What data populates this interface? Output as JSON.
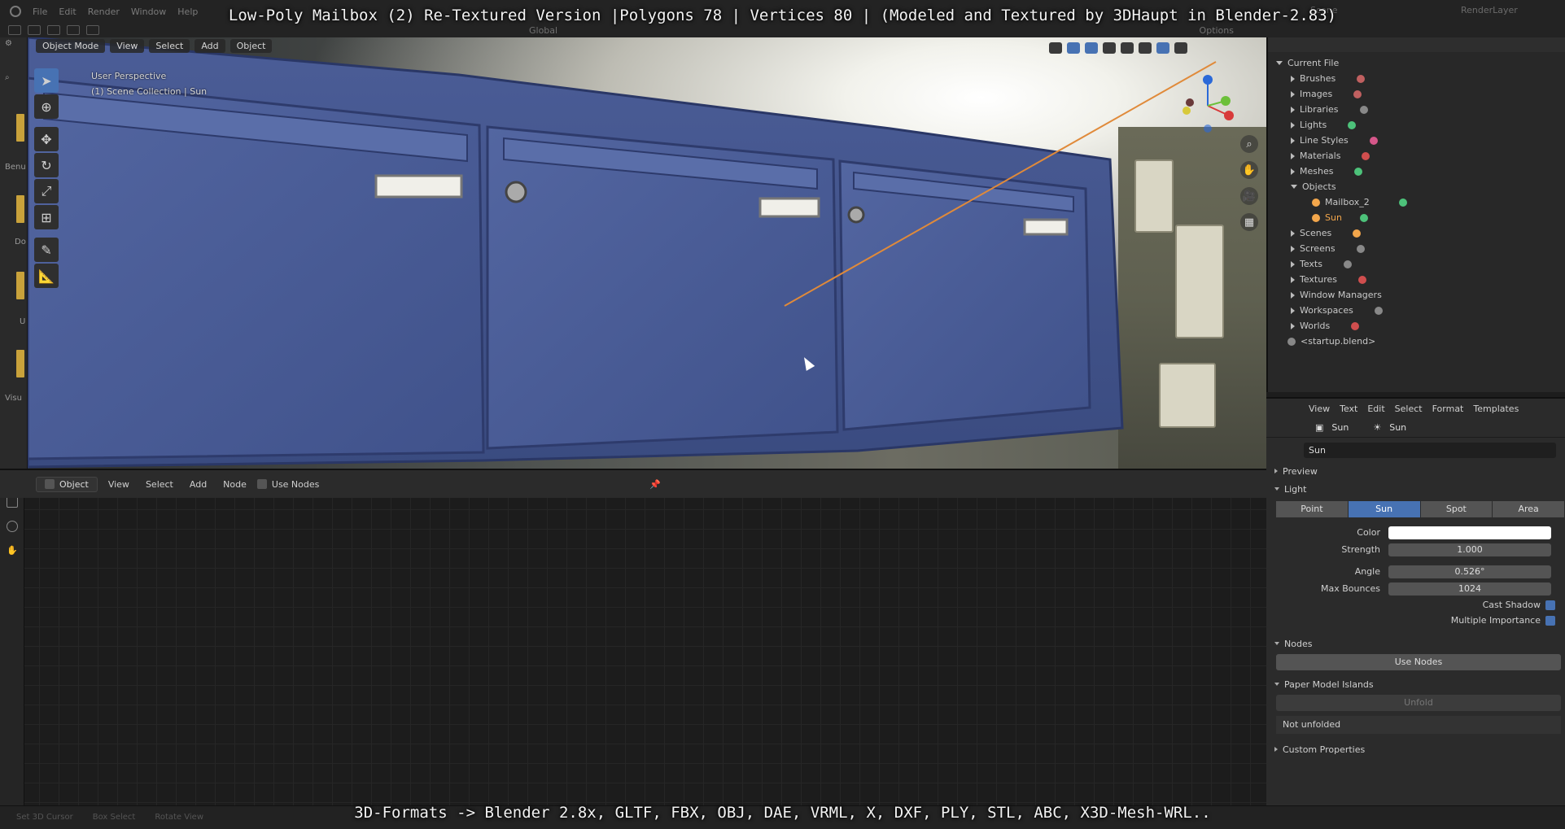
{
  "title_overlay": "Low-Poly Mailbox (2) Re-Textured Version |Polygons 78 | Vertices 80 | (Modeled and Textured by 3DHaupt in Blender-2.83)",
  "formats_overlay": "3D-Formats -> Blender 2.8x, GLTF, FBX, OBJ, DAE, VRML, X, DXF, PLY, STL, ABC, X3D-Mesh-WRL..",
  "top_menu": [
    "File",
    "Edit",
    "Render",
    "Window",
    "Help"
  ],
  "scene_label": "Scene",
  "render_layer_label": "RenderLayer",
  "options_label": "Options",
  "global_label": "Global",
  "left_strip_labels": [
    "Benu",
    "Do",
    "U",
    "Visu"
  ],
  "viewport": {
    "mode": "Object Mode",
    "menus": [
      "View",
      "Select",
      "Add",
      "Object"
    ],
    "info_line1": "User Perspective",
    "info_line2": "(1) Scene Collection | Sun"
  },
  "node_editor": {
    "mode": "Object",
    "menus": [
      "View",
      "Select",
      "Add",
      "Node"
    ],
    "use_nodes_label": "Use Nodes"
  },
  "outliner": {
    "root": "Current File",
    "items": [
      {
        "label": "Brushes"
      },
      {
        "label": "Images"
      },
      {
        "label": "Libraries"
      },
      {
        "label": "Lights"
      },
      {
        "label": "Line Styles"
      },
      {
        "label": "Materials"
      },
      {
        "label": "Meshes"
      },
      {
        "label": "Objects"
      },
      {
        "label": "Mailbox_2"
      },
      {
        "label": "Sun"
      },
      {
        "label": "Scenes"
      },
      {
        "label": "Screens"
      },
      {
        "label": "Texts"
      },
      {
        "label": "Textures"
      },
      {
        "label": "Window Managers"
      },
      {
        "label": "Workspaces"
      },
      {
        "label": "Worlds"
      },
      {
        "label": "<startup.blend>"
      }
    ]
  },
  "text_editor": {
    "menus": [
      "View",
      "Text",
      "Edit",
      "Select",
      "Format",
      "Templates"
    ]
  },
  "properties": {
    "object_name": "Sun",
    "data_name": "Sun",
    "name_field": "Sun",
    "sections": {
      "preview": "Preview",
      "light": "Light",
      "nodes": "Nodes",
      "paper_model": "Paper Model Islands",
      "custom_props": "Custom Properties"
    },
    "light_types": [
      "Point",
      "Sun",
      "Spot",
      "Area"
    ],
    "active_light_type": "Sun",
    "fields": {
      "color_label": "Color",
      "strength_label": "Strength",
      "strength_value": "1.000",
      "angle_label": "Angle",
      "angle_value": "0.526°",
      "max_bounces_label": "Max Bounces",
      "max_bounces_value": "1024"
    },
    "checkboxes": {
      "cast_shadow": "Cast Shadow",
      "multiple_importance": "Multiple Importance"
    },
    "use_nodes_button": "Use Nodes",
    "unfold_button": "Unfold",
    "not_unfolded": "Not unfolded"
  },
  "status_bar": {
    "left1": "Set 3D Cursor",
    "left2": "Box Select",
    "left3": "Rotate View"
  },
  "colors": {
    "accent": "#4772b3",
    "sun_orange": "#f3a64b",
    "mailbox_blue": "#3d4f86"
  }
}
